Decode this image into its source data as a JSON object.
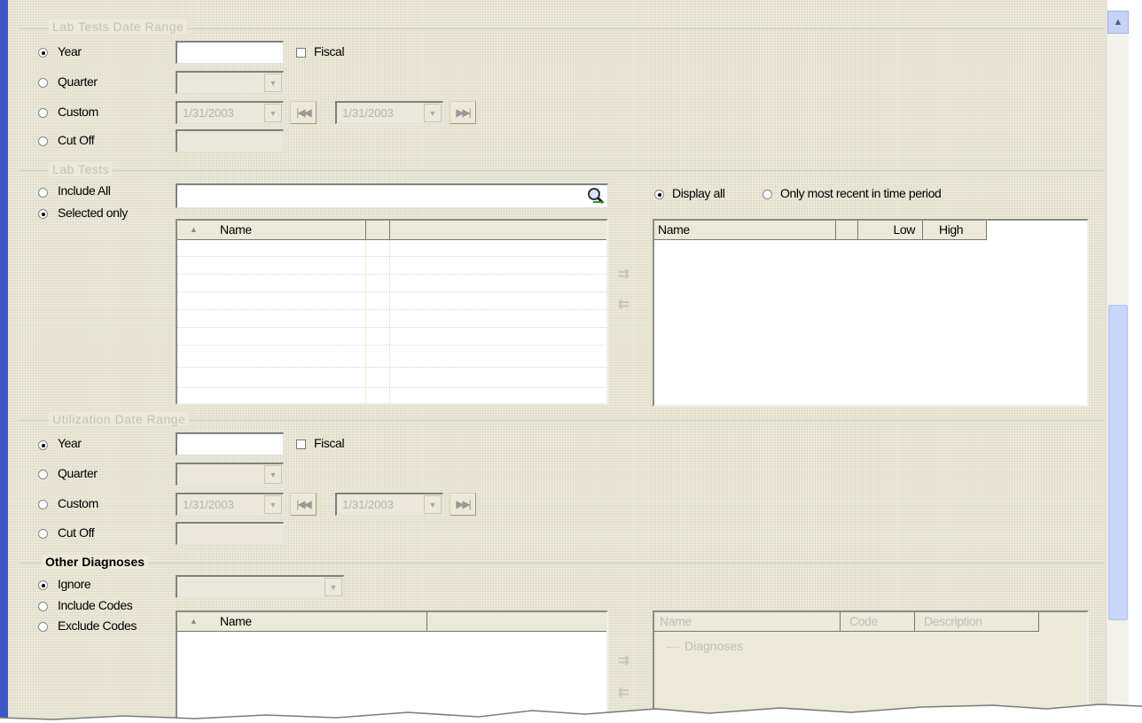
{
  "lab_tests_date_range": {
    "title": "Lab Tests Date Range",
    "options": [
      "Year",
      "Quarter",
      "Custom",
      "Cut Off"
    ],
    "selected": "Year",
    "year_value": "",
    "fiscal_label": "Fiscal",
    "fiscal_checked": false,
    "quarter_value": "",
    "custom_start": "1/31/2003",
    "custom_end": "1/31/2003",
    "first_icon": "first-record-icon",
    "last_icon": "last-record-icon",
    "cutoff_value": ""
  },
  "lab_tests": {
    "title": "Lab Tests",
    "options": [
      "Include All",
      "Selected only"
    ],
    "selected": "Selected only",
    "search_value": "",
    "search_icon": "magnifier-icon",
    "display_options": [
      "Display all",
      "Only most recent in time period"
    ],
    "display_selected": "Display all",
    "available_columns": [
      "Name",
      "",
      ""
    ],
    "selected_columns": [
      "Name",
      "",
      "Low",
      "High"
    ],
    "sort_indicator": "▲"
  },
  "utilization_date_range": {
    "title": "Utilization Date Range",
    "options": [
      "Year",
      "Quarter",
      "Custom",
      "Cut Off"
    ],
    "selected": "Year",
    "year_value": "",
    "fiscal_label": "Fiscal",
    "fiscal_checked": false,
    "quarter_value": "",
    "custom_start": "1/31/2003",
    "custom_end": "1/31/2003",
    "cutoff_value": ""
  },
  "other_diagnoses": {
    "title": "Other Diagnoses",
    "options": [
      "Ignore",
      "Include Codes",
      "Exclude Codes"
    ],
    "selected": "Ignore",
    "dropdown_value": "",
    "available_columns": [
      "Name",
      ""
    ],
    "selected_columns": [
      "Name",
      "Code",
      "Description"
    ],
    "tree_root": "Diagnoses",
    "sort_indicator": "▲"
  },
  "arrows": {
    "add": "⇉",
    "remove": "⇇"
  },
  "colors": {
    "window_border": "#3b57c4",
    "panel": "#ece9d8",
    "scroll_thumb": "#c8d6fb"
  }
}
